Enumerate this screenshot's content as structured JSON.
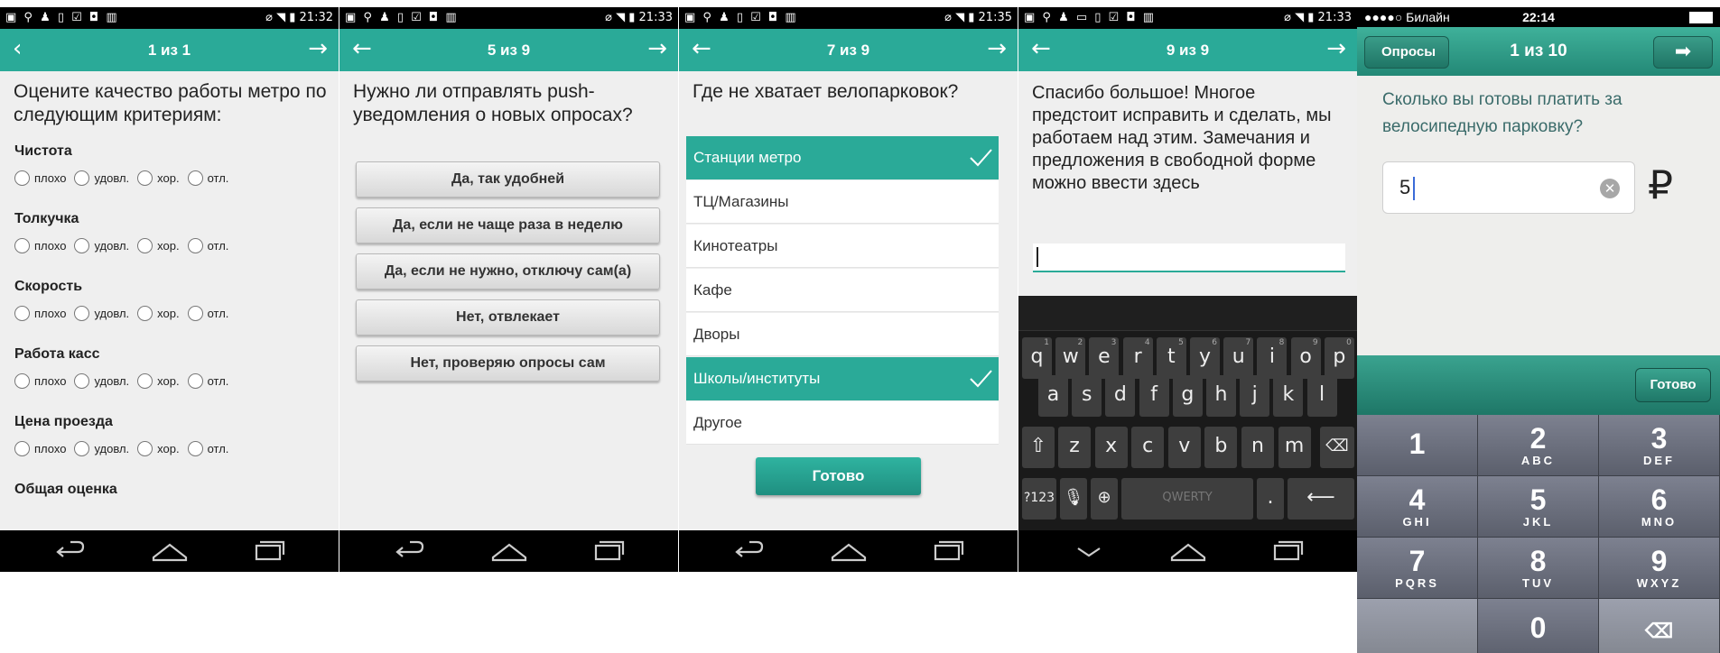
{
  "screens": [
    {
      "status_time": "21:32",
      "title": "1 из 1",
      "question": "Оцените качество работы метро по следующим критериям:",
      "criteria": [
        "Чистота",
        "Толкучка",
        "Скорость",
        "Работа касс",
        "Цена проезда",
        "Общая оценка"
      ],
      "rating_options": [
        "плохо",
        "удовл.",
        "хор.",
        "отл."
      ]
    },
    {
      "status_time": "21:33",
      "title": "5 из 9",
      "question": "Нужно ли отправлять push-уведомления о новых опросах?",
      "options": [
        "Да, так удобней",
        "Да, если не чаще раза в неделю",
        "Да, если не нужно, отключу сам(а)",
        "Нет, отвлекает",
        "Нет, проверяю опросы сам"
      ]
    },
    {
      "status_time": "21:35",
      "title": "7 из 9",
      "question": "Где не хватает велопарковок?",
      "items": [
        {
          "label": "Станции метро",
          "selected": true
        },
        {
          "label": "ТЦ/Магазины",
          "selected": false
        },
        {
          "label": "Кинотеатры",
          "selected": false
        },
        {
          "label": "Кафе",
          "selected": false
        },
        {
          "label": "Дворы",
          "selected": false
        },
        {
          "label": "Школы/институты",
          "selected": true
        },
        {
          "label": "Другое",
          "selected": false
        }
      ],
      "done_label": "Готово"
    },
    {
      "status_time": "21:33",
      "title": "9 из 9",
      "message": "Спасибо большое! Многое предстоит исправить и сделать, мы работаем над этим. Замечания и предложения в свободной форме можно ввести здесь",
      "input_value": "",
      "keyboard": {
        "row1": [
          "q",
          "w",
          "e",
          "r",
          "t",
          "y",
          "u",
          "i",
          "o",
          "p"
        ],
        "row1_hints": [
          "1",
          "2",
          "3",
          "4",
          "5",
          "6",
          "7",
          "8",
          "9",
          "0"
        ],
        "row2": [
          "a",
          "s",
          "d",
          "f",
          "g",
          "h",
          "j",
          "k",
          "l"
        ],
        "row3": [
          "z",
          "x",
          "c",
          "v",
          "b",
          "n",
          "m"
        ],
        "symbols_label": "?123",
        "space_label": "QWERTY",
        "period_label": "."
      }
    },
    {
      "carrier": "●●●●○ Билайн",
      "status_time": "22:14",
      "back_label": "Опросы",
      "title": "1 из 10",
      "question": "Сколько вы готовы платить за велосипедную парковку?",
      "input_value": "5",
      "currency": "₽",
      "done_label": "Готово",
      "keypad": [
        {
          "digit": "1",
          "letters": ""
        },
        {
          "digit": "2",
          "letters": "ABC"
        },
        {
          "digit": "3",
          "letters": "DEF"
        },
        {
          "digit": "4",
          "letters": "GHI"
        },
        {
          "digit": "5",
          "letters": "JKL"
        },
        {
          "digit": "6",
          "letters": "MNO"
        },
        {
          "digit": "7",
          "letters": "PQRS"
        },
        {
          "digit": "8",
          "letters": "TUV"
        },
        {
          "digit": "9",
          "letters": "WXYZ"
        },
        {
          "digit": "0",
          "letters": ""
        }
      ]
    }
  ],
  "colors": {
    "accent": "#2aaa98",
    "ios_accent": "#238876"
  },
  "icons": {
    "back": "arrow-left-icon",
    "forward": "arrow-right-icon",
    "check": "check-icon",
    "nav_back": "nav-back-icon",
    "nav_home": "nav-home-icon",
    "nav_recent": "nav-recent-icon"
  }
}
